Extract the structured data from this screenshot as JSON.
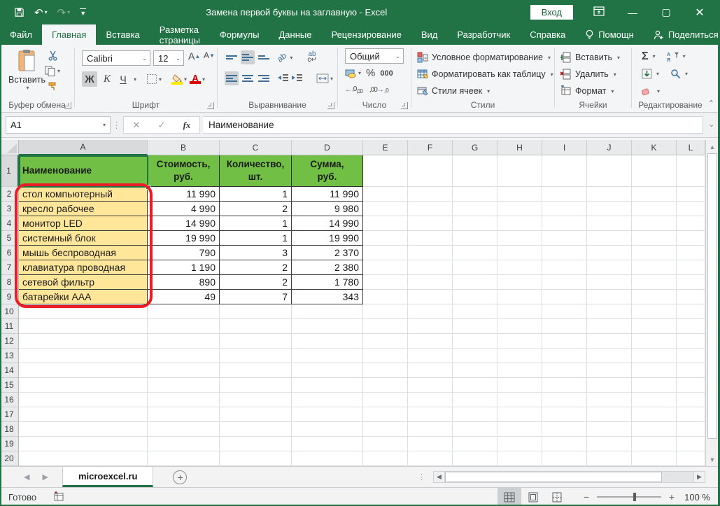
{
  "titlebar": {
    "title": "Замена первой буквы на заглавную  -  Excel",
    "signin": "Вход"
  },
  "tabs": {
    "items": [
      {
        "label": "Файл",
        "active": false
      },
      {
        "label": "Главная",
        "active": true
      },
      {
        "label": "Вставка",
        "active": false
      },
      {
        "label": "Разметка страницы",
        "active": false
      },
      {
        "label": "Формулы",
        "active": false
      },
      {
        "label": "Данные",
        "active": false
      },
      {
        "label": "Рецензирование",
        "active": false
      },
      {
        "label": "Вид",
        "active": false
      },
      {
        "label": "Разработчик",
        "active": false
      },
      {
        "label": "Справка",
        "active": false
      }
    ],
    "assistant": "Помощн",
    "share": "Поделиться"
  },
  "ribbon": {
    "clipboard": {
      "group": "Буфер обмена",
      "paste": "Вставить"
    },
    "font": {
      "group": "Шрифт",
      "family": "Calibri",
      "size": "12",
      "bold": "Ж",
      "italic": "К",
      "underline": "Ч"
    },
    "alignment": {
      "group": "Выравнивание"
    },
    "number": {
      "group": "Число",
      "format": "Общий",
      "percent": "%",
      "thousands": "000"
    },
    "styles": {
      "group": "Стили",
      "conditional": "Условное форматирование",
      "as_table": "Форматировать как таблицу",
      "cell_styles": "Стили ячеек"
    },
    "cells": {
      "group": "Ячейки",
      "insert": "Вставить",
      "delete": "Удалить",
      "format": "Формат"
    },
    "editing": {
      "group": "Редактирование",
      "autosum": "Σ"
    }
  },
  "formula_bar": {
    "name_box": "A1",
    "fx": "fx",
    "content": "Наименование"
  },
  "sheet": {
    "columns": [
      "A",
      "B",
      "C",
      "D",
      "E",
      "F",
      "G",
      "H",
      "I",
      "J",
      "K",
      "L"
    ],
    "row_count": 20,
    "selected_cell": "A1",
    "table": {
      "headers": [
        "Наименование",
        "Стоимость,\nруб.",
        "Количество,\nшт.",
        "Сумма,\nруб."
      ],
      "rows": [
        [
          "стол компьютерный",
          "11 990",
          "1",
          "11 990"
        ],
        [
          "кресло рабочее",
          "4 990",
          "2",
          "9 980"
        ],
        [
          "монитор LED",
          "14 990",
          "1",
          "14 990"
        ],
        [
          "системный блок",
          "19 990",
          "1",
          "19 990"
        ],
        [
          "мышь беспроводная",
          "790",
          "3",
          "2 370"
        ],
        [
          "клавиатура проводная",
          "1 190",
          "2",
          "2 380"
        ],
        [
          "сетевой фильтр",
          "890",
          "2",
          "1 780"
        ],
        [
          "батарейки AAA",
          "49",
          "7",
          "343"
        ]
      ]
    },
    "colors": {
      "table_header_fill": "#71bf44",
      "name_column_fill": "#ffe699",
      "annotation": "#ec1c24",
      "selection": "#217346"
    }
  },
  "sheet_bar": {
    "active_tab": "microexcel.ru"
  },
  "status_bar": {
    "ready": "Готово",
    "zoom": "100 %"
  }
}
